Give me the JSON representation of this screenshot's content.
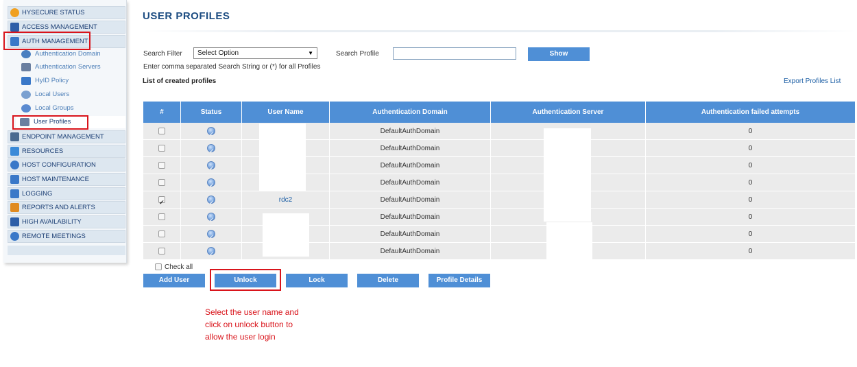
{
  "sidebar": {
    "items": [
      {
        "label": "HYSECURE STATUS",
        "icon": "status-icon",
        "color": "#f0a020"
      },
      {
        "label": "ACCESS MANAGEMENT",
        "icon": "access-icon",
        "color": "#2d5ea8"
      },
      {
        "label": "AUTH MANAGEMENT",
        "icon": "lock-icon",
        "color": "#3a78c8"
      },
      {
        "label": "ENDPOINT MANAGEMENT",
        "icon": "scales-icon",
        "color": "#4a6a90"
      },
      {
        "label": "RESOURCES",
        "icon": "resources-icon",
        "color": "#3a8ad8"
      },
      {
        "label": "HOST CONFIGURATION",
        "icon": "gear-icon",
        "color": "#3a78c8"
      },
      {
        "label": "HOST MAINTENANCE",
        "icon": "monitor-icon",
        "color": "#3a78c8"
      },
      {
        "label": "LOGGING",
        "icon": "logging-icon",
        "color": "#3a78c8"
      },
      {
        "label": "REPORTS AND ALERTS",
        "icon": "bar-chart-icon",
        "color": "#e08a20"
      },
      {
        "label": "HIGH AVAILABILITY",
        "icon": "grid-icon",
        "color": "#2d5ea8"
      },
      {
        "label": "REMOTE MEETINGS",
        "icon": "meeting-icon",
        "color": "#3a78c8"
      }
    ],
    "subitems": [
      {
        "label": "Authentication Domain",
        "icon": "globe-icon",
        "color": "#4a7fc0"
      },
      {
        "label": "Authentication Servers",
        "icon": "server-icon",
        "color": "#6a7fa0"
      },
      {
        "label": "HyID Policy",
        "icon": "user-badge-icon",
        "color": "#3a78c8"
      },
      {
        "label": "Local Users",
        "icon": "user-icon",
        "color": "#7aa0d0"
      },
      {
        "label": "Local Groups",
        "icon": "group-icon",
        "color": "#5a8ad0"
      },
      {
        "label": "User Profiles",
        "icon": "profile-icon",
        "color": "#6a7fa0"
      }
    ]
  },
  "page": {
    "title": "USER PROFILES"
  },
  "search": {
    "filter_label": "Search Filter",
    "filter_value": "Select Option",
    "profile_label": "Search Profile",
    "profile_value": "",
    "show_label": "Show",
    "hint": "Enter comma separated Search String or (*) for all Profiles"
  },
  "list": {
    "title": "List of created profiles",
    "export_label": "Export Profiles List"
  },
  "table": {
    "headers": [
      "#",
      "Status",
      "User Name",
      "Authentication Domain",
      "Authentication Server",
      "Authentication failed attempts"
    ],
    "rows": [
      {
        "checked": false,
        "user": "",
        "domain": "DefaultAuthDomain",
        "server": "",
        "failed": "0"
      },
      {
        "checked": false,
        "user": "",
        "domain": "DefaultAuthDomain",
        "server": "",
        "failed": "0"
      },
      {
        "checked": false,
        "user": "",
        "domain": "DefaultAuthDomain",
        "server": "",
        "failed": "0"
      },
      {
        "checked": false,
        "user": "",
        "domain": "DefaultAuthDomain",
        "server": "",
        "failed": "0"
      },
      {
        "checked": true,
        "user": "rdc2",
        "domain": "DefaultAuthDomain",
        "server": "",
        "failed": "0"
      },
      {
        "checked": false,
        "user": "",
        "domain": "DefaultAuthDomain",
        "server": "",
        "failed": "0"
      },
      {
        "checked": false,
        "user": "",
        "domain": "DefaultAuthDomain",
        "server": "",
        "failed": "0"
      },
      {
        "checked": false,
        "user": "",
        "domain": "DefaultAuthDomain",
        "server": "",
        "failed": "0"
      }
    ]
  },
  "actions": {
    "check_all_label": "Check all",
    "add_user": "Add User",
    "unlock": "Unlock",
    "lock": "Lock",
    "delete": "Delete",
    "profile_details": "Profile Details"
  },
  "annotation": {
    "note": "Select the user name and click on unlock button to allow the user login"
  },
  "colors": {
    "accent": "#4f8fd6",
    "title": "#1d4d82",
    "callout": "#d9141b",
    "row_bg": "#ebebeb"
  }
}
